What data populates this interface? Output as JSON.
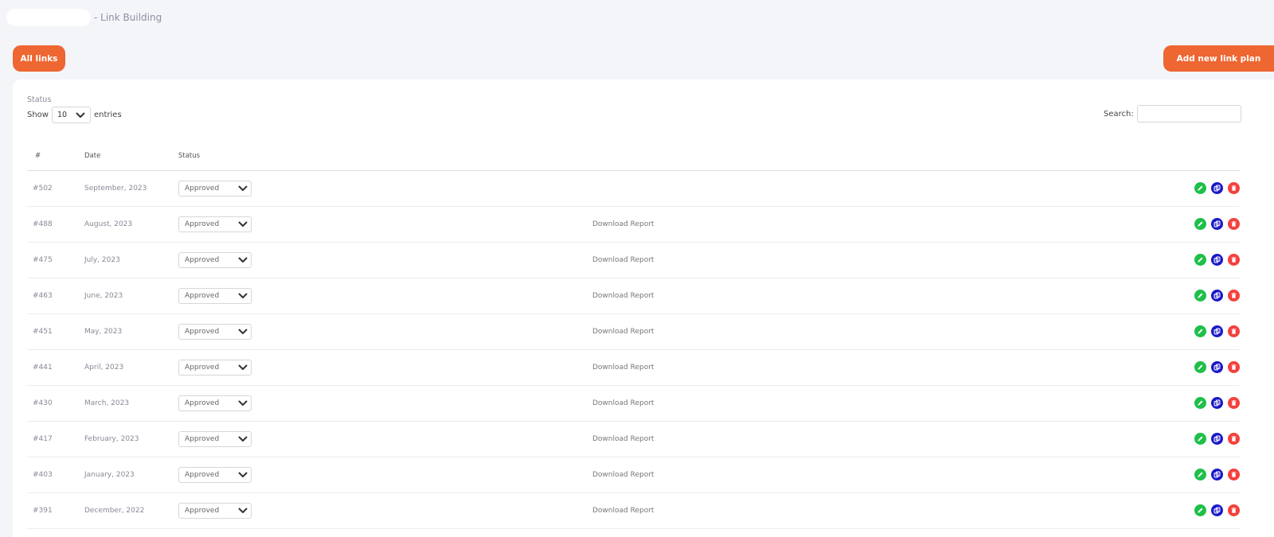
{
  "header": {
    "title": "- Link Building"
  },
  "buttons": {
    "all_links": "All links",
    "add_new": "Add new link plan"
  },
  "filters": {
    "status_label": "Status",
    "show_label": "Show",
    "entries_value": "10",
    "entries_label": "entries",
    "search_label": "Search:",
    "search_value": ""
  },
  "table": {
    "columns": {
      "id": "#",
      "date": "Date",
      "status": "Status"
    },
    "rows": [
      {
        "id": "#502",
        "date": "September, 2023",
        "status": "Approved",
        "report": ""
      },
      {
        "id": "#488",
        "date": "August, 2023",
        "status": "Approved",
        "report": "Download Report"
      },
      {
        "id": "#475",
        "date": "July, 2023",
        "status": "Approved",
        "report": "Download Report"
      },
      {
        "id": "#463",
        "date": "June, 2023",
        "status": "Approved",
        "report": "Download Report"
      },
      {
        "id": "#451",
        "date": "May, 2023",
        "status": "Approved",
        "report": "Download Report"
      },
      {
        "id": "#441",
        "date": "April, 2023",
        "status": "Approved",
        "report": "Download Report"
      },
      {
        "id": "#430",
        "date": "March, 2023",
        "status": "Approved",
        "report": "Download Report"
      },
      {
        "id": "#417",
        "date": "February, 2023",
        "status": "Approved",
        "report": "Download Report"
      },
      {
        "id": "#403",
        "date": "January, 2023",
        "status": "Approved",
        "report": "Download Report"
      },
      {
        "id": "#391",
        "date": "December, 2022",
        "status": "Approved",
        "report": "Download Report"
      }
    ]
  },
  "icons": {
    "edit": "pencil-icon",
    "copy": "copy-icon",
    "delete": "trash-icon",
    "dropdown": "chevron-down-icon"
  },
  "colors": {
    "accent": "#ee6631",
    "edit": "#1fbf4a",
    "copy": "#1a17c8",
    "delete": "#f4403d",
    "background": "#f4f5f9"
  }
}
